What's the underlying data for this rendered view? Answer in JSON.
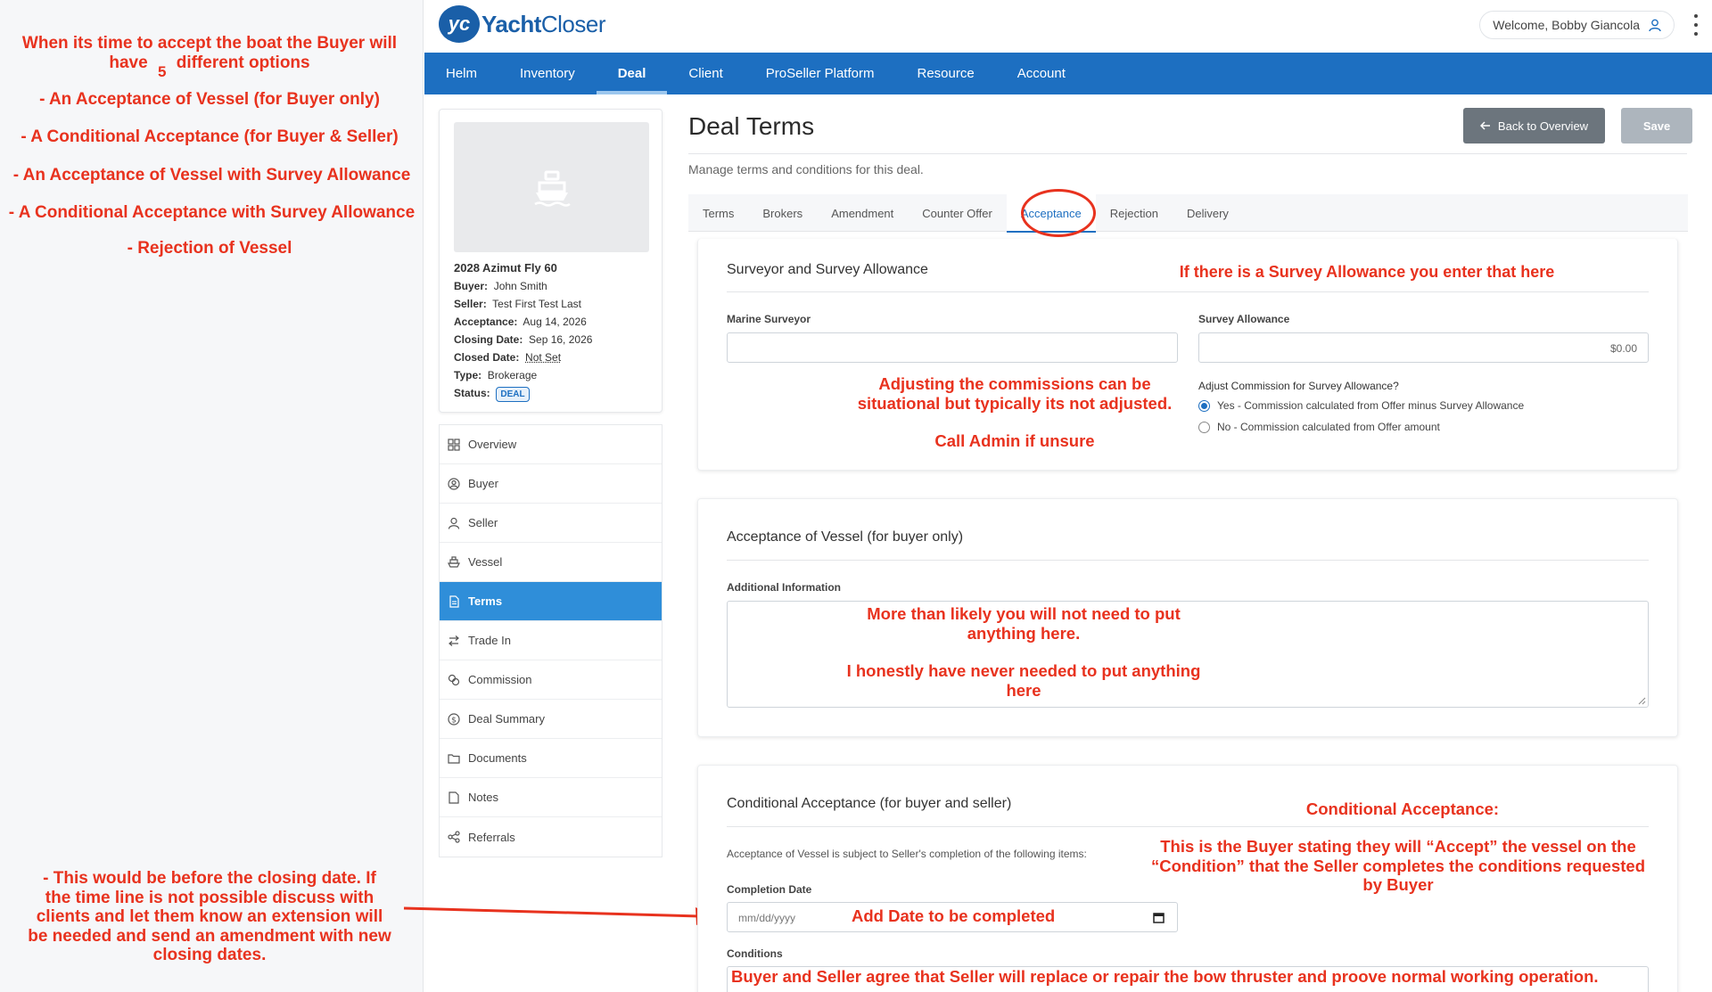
{
  "annotations": {
    "options_title_1": "When its time to accept the boat the Buyer will",
    "options_title_2": "have",
    "options_title_count": "5",
    "options_title_3": "different options",
    "option_1": "- An Acceptance of Vessel (for Buyer only)",
    "option_2": "- A Conditional Acceptance (for Buyer & Seller)",
    "option_3": "- An Acceptance of Vessel with Survey Allowance",
    "option_4": "- A Conditional Acceptance with Survey Allowance",
    "option_5": "- Rejection of Vessel",
    "closing_note_1": "-  This would be before the closing date. If",
    "closing_note_2": "the time line is not possible discuss with",
    "closing_note_3": "clients and let them know an extension will",
    "closing_note_4": "be needed and send an amendment with new",
    "closing_note_5": "closing dates.",
    "survey_note": "If there is a Survey Allowance you enter that here",
    "commission_note_1": "Adjusting the commissions can be",
    "commission_note_2": "situational but typically its not adjusted.",
    "commission_note_3": "Call Admin if unsure",
    "additional_note_1": "More than likely you will not need to put",
    "additional_note_2": "anything here.",
    "additional_note_3": "I honestly have never needed to put anything",
    "additional_note_4": "here",
    "conditional_title": "Conditional Acceptance:",
    "conditional_note_1": "This is the Buyer stating they will “Accept” the vessel on the",
    "conditional_note_2": "“Condition” that the Seller completes the conditions requested",
    "conditional_note_3": "by Buyer",
    "date_note": "Add Date to be completed",
    "conditions_text": "Buyer and Seller agree that Seller will replace or repair the bow thruster and proove normal working operation."
  },
  "header": {
    "logo_badge": "yc",
    "logo_bold": "Yacht",
    "logo_light": "Closer",
    "welcome": "Welcome, Bobby Giancola"
  },
  "nav": [
    "Helm",
    "Inventory",
    "Deal",
    "Client",
    "ProSeller Platform",
    "Resource",
    "Account"
  ],
  "deal": {
    "name": "2028 Azimut Fly 60",
    "buyer_label": "Buyer:",
    "buyer": "John Smith",
    "seller_label": "Seller:",
    "seller": "Test First Test Last",
    "acceptance_label": "Acceptance:",
    "acceptance": "Aug 14, 2026",
    "closing_label": "Closing Date:",
    "closing": "Sep 16, 2026",
    "closed_label": "Closed Date:",
    "closed": "Not Set",
    "type_label": "Type:",
    "type": "Brokerage",
    "status_label": "Status:",
    "status": "DEAL"
  },
  "side_menu": [
    "Overview",
    "Buyer",
    "Seller",
    "Vessel",
    "Terms",
    "Trade In",
    "Commission",
    "Deal Summary",
    "Documents",
    "Notes",
    "Referrals"
  ],
  "page": {
    "title": "Deal Terms",
    "subtitle": "Manage terms and conditions for this deal.",
    "back_label": "Back to Overview",
    "save_label": "Save"
  },
  "tabs": [
    "Terms",
    "Brokers",
    "Amendment",
    "Counter Offer",
    "Acceptance",
    "Rejection",
    "Delivery"
  ],
  "survey": {
    "title": "Surveyor and Survey Allowance",
    "surveyor_label": "Marine Surveyor",
    "surveyor_value": "",
    "allowance_label": "Survey Allowance",
    "allowance_value": "$0.00",
    "adjust_question": "Adjust Commission for Survey Allowance?",
    "option_yes": "Yes - Commission calculated from Offer minus Survey Allowance",
    "option_no": "No - Commission calculated from Offer amount"
  },
  "acceptance": {
    "title": "Acceptance of Vessel (for buyer only)",
    "additional_label": "Additional Information"
  },
  "conditional": {
    "title": "Conditional Acceptance (for buyer and seller)",
    "description": "Acceptance of Vessel is subject to Seller's completion of the following items:",
    "date_label": "Completion Date",
    "date_placeholder": "mm/dd/yyyy",
    "conditions_label": "Conditions"
  },
  "colors": {
    "nav": "#1d6fc1",
    "annotation": "#e8321e",
    "active_menu": "#2f8ed9"
  }
}
